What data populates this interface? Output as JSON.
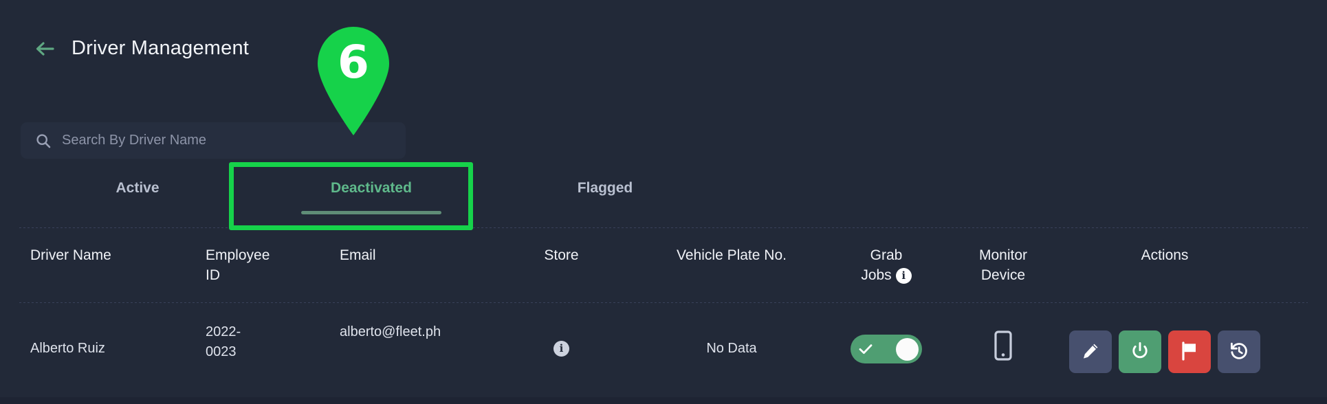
{
  "header": {
    "back_icon": "arrow-left-icon",
    "title": "Driver Management"
  },
  "search": {
    "icon": "search-icon",
    "value": "",
    "placeholder": "Search By Driver Name"
  },
  "annotation": {
    "marker_number": "6",
    "marker_color": "#16d24a",
    "highlight_target": "Deactivated"
  },
  "tabs": [
    {
      "label": "Active",
      "active": false
    },
    {
      "label": "Deactivated",
      "active": true
    },
    {
      "label": "Flagged",
      "active": false
    }
  ],
  "table": {
    "columns": [
      {
        "key": "driver_name",
        "label": "Driver Name"
      },
      {
        "key": "employee_id",
        "label": "Employee\nID"
      },
      {
        "key": "email",
        "label": "Email"
      },
      {
        "key": "store",
        "label": "Store"
      },
      {
        "key": "vehicle_plate_no",
        "label": "Vehicle Plate No."
      },
      {
        "key": "grab_jobs",
        "label": "Grab\nJobs",
        "info_icon": "info-icon"
      },
      {
        "key": "monitor_device",
        "label": "Monitor\nDevice"
      },
      {
        "key": "actions",
        "label": "Actions"
      }
    ],
    "rows": [
      {
        "driver_name": "Alberto Ruiz",
        "employee_id": "2022-\n0023",
        "email": "alberto@fleet.ph",
        "store_icon": "info-icon",
        "vehicle_plate_no": "No Data",
        "grab_jobs_on": true,
        "grab_jobs_icon": "toggle-on-icon",
        "monitor_device_icon": "mobile-phone-icon",
        "actions": [
          {
            "name": "edit",
            "icon": "pencil-icon",
            "color": "#47506e"
          },
          {
            "name": "deactivate",
            "icon": "power-icon",
            "color": "#4f9e72"
          },
          {
            "name": "flag",
            "icon": "flag-icon",
            "color": "#d9453f"
          },
          {
            "name": "history",
            "icon": "history-icon",
            "color": "#47506e"
          }
        ]
      }
    ]
  },
  "theme": {
    "background": "#222938",
    "panel": "#262e3f",
    "accent_green": "#5fb98b",
    "highlight_green": "#16d24a",
    "danger_red": "#d9453f"
  }
}
